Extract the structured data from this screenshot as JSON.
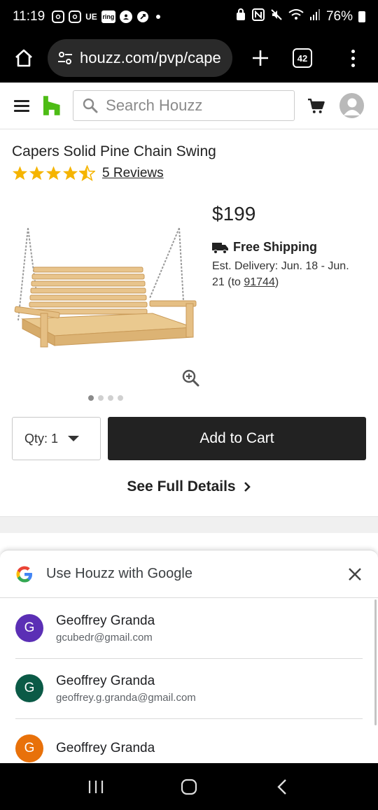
{
  "status_bar": {
    "time": "11:19",
    "left_icons": [
      "instagram-icon",
      "instagram-icon",
      "ue-icon",
      "ring-icon",
      "account-icon",
      "rocket-icon",
      "dot-icon"
    ],
    "ue_label": "UE",
    "ring_label": "ring",
    "battery_percent": "76%"
  },
  "browser": {
    "url": "houzz.com/pvp/cape",
    "tab_count": "42"
  },
  "header": {
    "search_placeholder": "Search Houzz"
  },
  "product": {
    "title": "Capers Solid Pine Chain Swing",
    "rating": 4.5,
    "reviews_label": "5 Reviews",
    "price": "$199",
    "shipping": "Free Shipping",
    "delivery_prefix": "Est. Delivery: Jun. 18 - Jun. 21 (to ",
    "delivery_zip": "91744",
    "delivery_suffix": ")",
    "image_count": 4,
    "active_image_index": 0,
    "qty_label": "Qty: 1",
    "add_to_cart": "Add to Cart",
    "see_full_details": "See Full Details"
  },
  "google_sheet": {
    "title": "Use Houzz with Google",
    "accounts": [
      {
        "initial": "G",
        "name": "Geoffrey Granda",
        "email": "gcubedr@gmail.com",
        "color": "#5b2fb5"
      },
      {
        "initial": "G",
        "name": "Geoffrey Granda",
        "email": "geoffrey.g.granda@gmail.com",
        "color": "#0b5a46"
      },
      {
        "initial": "G",
        "name": "Geoffrey Granda",
        "email": "",
        "color": "#e8710a"
      }
    ]
  },
  "colors": {
    "houzz_green": "#4dbc15",
    "star_gold": "#f5b400",
    "button_dark": "#222222"
  }
}
